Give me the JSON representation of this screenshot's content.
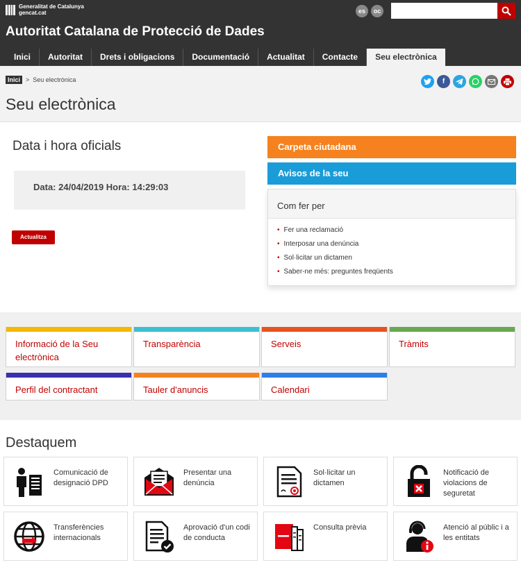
{
  "header": {
    "gencat_line1": "Generalitat de Catalunya",
    "gencat_line2": "gencat.cat",
    "lang_es": "es",
    "lang_oc": "oc",
    "search_placeholder": "",
    "site_title": "Autoritat Catalana de Protecció de Dades"
  },
  "nav": {
    "items": [
      "Inici",
      "Autoritat",
      "Drets i obligacions",
      "Documentació",
      "Actualitat",
      "Contacte",
      "Seu electrònica"
    ],
    "active": "Seu electrònica"
  },
  "breadcrumb": {
    "home": "Inici",
    "separator": ">",
    "current": "Seu electrònica"
  },
  "share_icons": [
    "twitter-icon",
    "facebook-icon",
    "telegram-icon",
    "whatsapp-icon",
    "email-icon",
    "print-icon"
  ],
  "page_title": "Seu electrònica",
  "date_section": {
    "heading": "Data i hora oficials",
    "datetime": "Data: 24/04/2019 Hora: 14:29:03",
    "refresh_label": "Actualitza"
  },
  "sidebar": {
    "carpeta": "Carpeta ciutadana",
    "avisos": "Avisos de la seu",
    "howto_title": "Com fer per",
    "howto_items": [
      "Fer una reclamació",
      "Interposar una denúncia",
      "Sol·licitar un dictamen",
      "Saber-ne més: preguntes freqüents"
    ]
  },
  "tiles": [
    {
      "label": "Informació de la Seu electrònica",
      "color": "#f5b800"
    },
    {
      "label": "Transparència",
      "color": "#3cbfd0"
    },
    {
      "label": "Serveis",
      "color": "#e8521f"
    },
    {
      "label": "Tràmits",
      "color": "#6aa84f"
    },
    {
      "label": "Perfil del contractant",
      "color": "#3a2fb0"
    },
    {
      "label": "Tauler d'anuncis",
      "color": "#f5821f"
    },
    {
      "label": "Calendari",
      "color": "#2f7ee8"
    }
  ],
  "destaquem": {
    "title": "Destaquem",
    "cards": [
      {
        "label": "Comunicació de designació DPD",
        "icon": "person-document-icon"
      },
      {
        "label": "Presentar una denúncia",
        "icon": "envelope-icon"
      },
      {
        "label": "Sol·licitar un dictamen",
        "icon": "document-seal-icon"
      },
      {
        "label": "Notificació de violacions de seguretat",
        "icon": "padlock-icon"
      },
      {
        "label": "Transferències internacionals",
        "icon": "globe-icon"
      },
      {
        "label": "Aprovació d'un codi de conducta",
        "icon": "document-check-icon"
      },
      {
        "label": "Consulta prèvia",
        "icon": "documents-icon"
      },
      {
        "label": "Atenció al públic i a les entitats",
        "icon": "support-agent-icon"
      }
    ]
  },
  "colors": {
    "brand_red": "#c00000",
    "header_bg": "#333333",
    "orange": "#f5821f",
    "blue": "#1a9cd8"
  }
}
